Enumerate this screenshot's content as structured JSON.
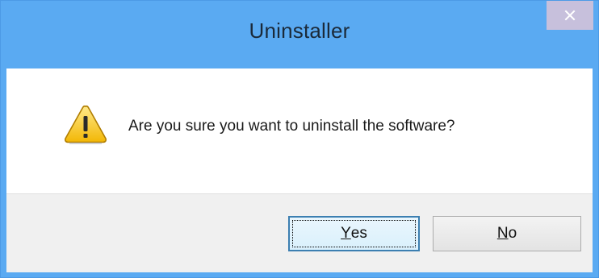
{
  "window": {
    "title": "Uninstaller",
    "close_icon": "close-icon",
    "titlebar_color": "#5aaaf2",
    "close_button_color": "#c7c0dc"
  },
  "message": {
    "icon": "warning-icon",
    "text": "Are you sure you want to uninstall the software?"
  },
  "buttons": {
    "yes": {
      "mnemonic": "Y",
      "rest": "es"
    },
    "no": {
      "mnemonic": "N",
      "rest": "o"
    }
  }
}
